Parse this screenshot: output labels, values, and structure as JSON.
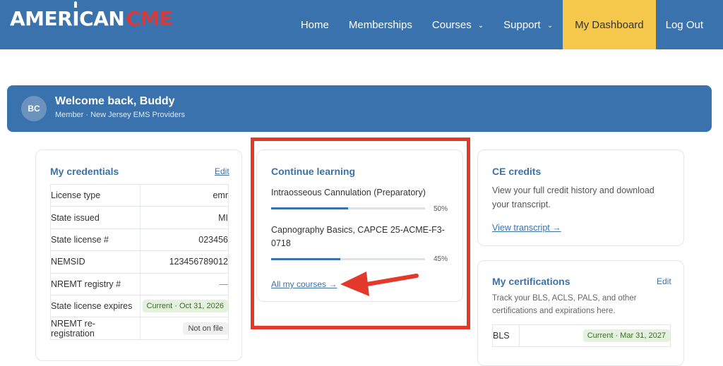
{
  "brand": {
    "logo_white": "AMERICAN",
    "logo_white_a": "AMER",
    "logo_white_i": "I",
    "logo_white_b": "CAN",
    "logo_red": "CME"
  },
  "nav": {
    "items": [
      {
        "label": "Home",
        "has_dropdown": false
      },
      {
        "label": "Memberships",
        "has_dropdown": false
      },
      {
        "label": "Courses",
        "has_dropdown": true
      },
      {
        "label": "Support",
        "has_dropdown": true
      },
      {
        "label": "My Dashboard",
        "has_dropdown": false
      },
      {
        "label": "Log Out",
        "has_dropdown": false
      }
    ]
  },
  "welcome": {
    "initials": "BC",
    "title": "Welcome back, Buddy",
    "subtitle": "Member · New Jersey EMS Providers"
  },
  "credentials": {
    "title": "My credentials",
    "edit_label": "Edit",
    "rows": [
      {
        "label": "License type",
        "value": "emr"
      },
      {
        "label": "State issued",
        "value": "MI"
      },
      {
        "label": "State license #",
        "value": "023456"
      },
      {
        "label": "NEMSID",
        "value": "123456789012"
      },
      {
        "label": "NREMT registry #",
        "value": "—"
      },
      {
        "label": "State license expires",
        "value": "Current · Oct 31, 2026"
      },
      {
        "label": "NREMT re-registration",
        "value": "Not on file"
      }
    ]
  },
  "learning": {
    "title": "Continue learning",
    "courses": [
      {
        "name": "Intraosseous Cannulation (Preparatory)",
        "progress": 50,
        "progress_label": "50%"
      },
      {
        "name": "Capnography Basics, CAPCE 25-ACME-F3-0718",
        "progress": 45,
        "progress_label": "45%"
      }
    ],
    "all_courses_label": "All my courses →"
  },
  "ce_credits": {
    "title": "CE credits",
    "description": "View your full credit history and download your transcript.",
    "link_label": "View transcript →"
  },
  "certifications": {
    "title": "My certifications",
    "edit_label": "Edit",
    "description": "Track your BLS, ACLS, PALS, and other certifications and expirations here.",
    "rows": [
      {
        "label": "BLS",
        "value": "Current · Mar 31, 2027"
      }
    ]
  },
  "colors": {
    "header": "#3a72ad",
    "dashboard_button": "#f5c84b",
    "logo_red": "#d83a3a",
    "highlight_box": "#e3392b",
    "badge_green_bg": "#e4f1de"
  },
  "annotations": {
    "highlight_box": "red-rectangle",
    "arrow": "red-arrow-pointing-left"
  }
}
